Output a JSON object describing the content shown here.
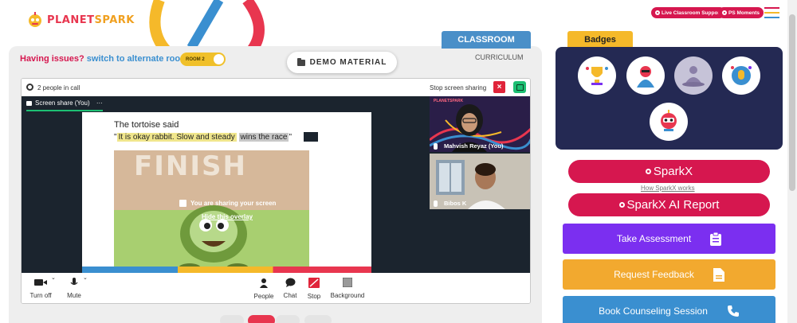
{
  "brand": {
    "logo_planet": "PLANET",
    "logo_spark": "SPARK",
    "primary": "#d6174f",
    "accent_yellow": "#f5b92a",
    "accent_blue": "#4a8fc8",
    "accent_purple": "#7b2ff0",
    "accent_orange": "#f2a92f",
    "accent_sky": "#3a8fd0"
  },
  "header": {
    "live_support_label": "Live Classroom Support",
    "ps_moments_label": "PS Moments"
  },
  "left": {
    "tab_classroom": "CLASSROOM",
    "tab_curriculum": "CURRICULUM",
    "issues_text": "Having issues?",
    "switch_link": "switch to alternate room",
    "room_label": "ROOM 2",
    "demo_material_label": "DEMO MATERIAL"
  },
  "call": {
    "people_count": "2 people in call",
    "stop_sharing_label": "Stop screen sharing",
    "screen_share_tab": "Screen share (You)",
    "tab_menu": "···",
    "overlay_message": "You are sharing your screen",
    "overlay_hide": "Hide this overlay",
    "slide_title": "The tortoise said",
    "quote_open": "\"",
    "quote_hl1": "It is okay rabbit. Slow and steady",
    "quote_hl2": "wins the race",
    "quote_close": "\"",
    "slide_finish": "FINISH",
    "tile_logo": "PLANETSPARK",
    "participants": [
      {
        "name": "Mahvish Reyaz (You)"
      },
      {
        "name": "Bibos K"
      }
    ],
    "controls": {
      "camera": "Turn off",
      "mic": "Mute",
      "people": "People",
      "chat": "Chat",
      "stop": "Stop",
      "background": "Background"
    }
  },
  "right": {
    "badges_title": "Badges",
    "sparkx_label": "SparkX",
    "how_sparkx": "How SparkX works",
    "sparkx_report_label": "SparkX AI Report",
    "take_assessment": "Take Assessment",
    "request_feedback": "Request Feedback",
    "book_counseling": "Book Counseling Session"
  }
}
